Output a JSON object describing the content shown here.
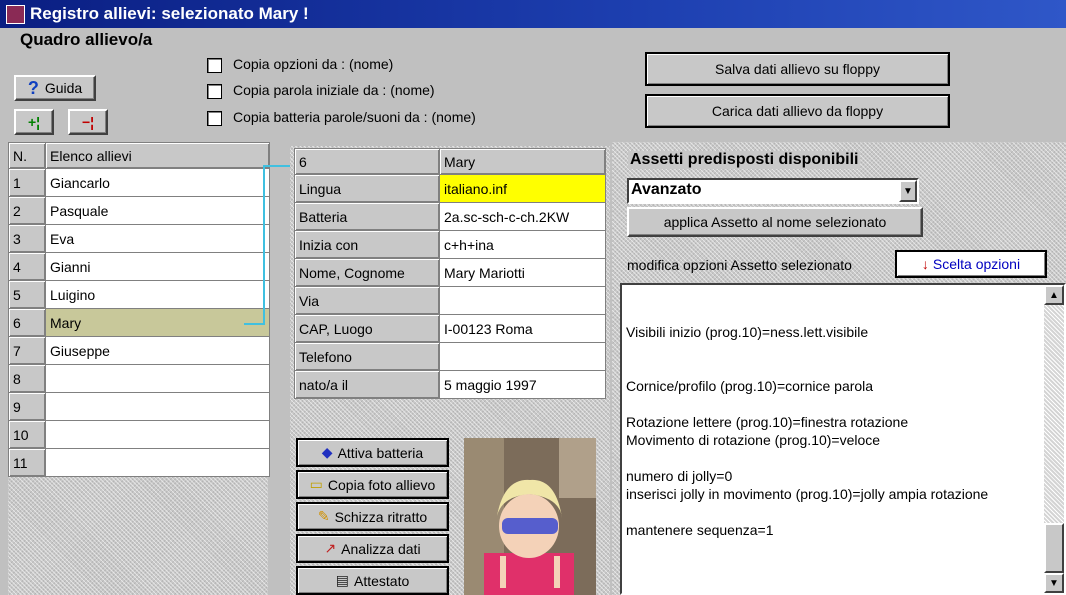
{
  "window": {
    "title": "Registro allievi: selezionato Mary !"
  },
  "header": {
    "title": "Quadro allievo/a",
    "guide_label": "Guida",
    "add_label": "+¦",
    "remove_label": "−¦"
  },
  "checkboxes": [
    {
      "label": "Copia opzioni da : (nome)"
    },
    {
      "label": "Copia parola iniziale da : (nome)"
    },
    {
      "label": "Copia batteria parole/suoni da : (nome)"
    }
  ],
  "floppy": {
    "save_label": "Salva dati allievo su floppy",
    "load_label": "Carica dati allievo da floppy"
  },
  "student_list": {
    "col_num": "N.",
    "col_name": "Elenco allievi",
    "rows": [
      {
        "n": "1",
        "name": "Giancarlo"
      },
      {
        "n": "2",
        "name": "Pasquale"
      },
      {
        "n": "3",
        "name": "Eva"
      },
      {
        "n": "4",
        "name": "Gianni"
      },
      {
        "n": "5",
        "name": "Luigino"
      },
      {
        "n": "6",
        "name": "Mary"
      },
      {
        "n": "7",
        "name": "Giuseppe"
      },
      {
        "n": "8",
        "name": ""
      },
      {
        "n": "9",
        "name": ""
      },
      {
        "n": "10",
        "name": ""
      },
      {
        "n": "11",
        "name": ""
      }
    ],
    "selected_index": 5
  },
  "details": {
    "header_num": "6",
    "header_name": "Mary",
    "rows": [
      {
        "label": "Lingua",
        "value": "italiano.inf"
      },
      {
        "label": "Batteria",
        "value": "2a.sc-sch-c-ch.2KW"
      },
      {
        "label": "Inizia con",
        "value": "c+h+ina"
      },
      {
        "label": "Nome, Cognome",
        "value": "Mary Mariotti"
      },
      {
        "label": "Via",
        "value": ""
      },
      {
        "label": "CAP, Luogo",
        "value": "I-00123 Roma"
      },
      {
        "label": "Telefono",
        "value": ""
      },
      {
        "label": "nato/a il",
        "value": "5 maggio 1997"
      }
    ]
  },
  "actions": [
    {
      "label": "Attiva batteria",
      "icon": "battery-icon"
    },
    {
      "label": "Copia foto allievo",
      "icon": "folder-icon"
    },
    {
      "label": "Schizza ritratto",
      "icon": "pencil-icon"
    },
    {
      "label": "Analizza dati",
      "icon": "graph-icon"
    },
    {
      "label": "Attestato",
      "icon": "certificate-icon"
    }
  ],
  "assetti": {
    "title": "Assetti predisposti disponibili",
    "selected": "Avanzato",
    "apply_label": "applica Assetto al nome selezionato",
    "modify_label": "modifica opzioni Assetto selezionato",
    "options_label": "Scelta opzioni",
    "options_text_color": "#0000c0",
    "text_lines": [
      "",
      "",
      "Visibili inizio (prog.10)=ness.lett.visibile",
      "",
      "",
      "Cornice/profilo (prog.10)=cornice parola",
      "",
      "Rotazione lettere (prog.10)=finestra rotazione",
      "Movimento di rotazione (prog.10)=veloce",
      "",
      "numero di jolly=0",
      "inserisci jolly in movimento (prog.10)=jolly ampia rotazione",
      "",
      "mantenere sequenza=1"
    ]
  },
  "colors": {
    "titlebar": "#0a1e82",
    "selected_row": "#c8c89a",
    "highlight": "#ffff00",
    "connector": "#40c0e0"
  }
}
